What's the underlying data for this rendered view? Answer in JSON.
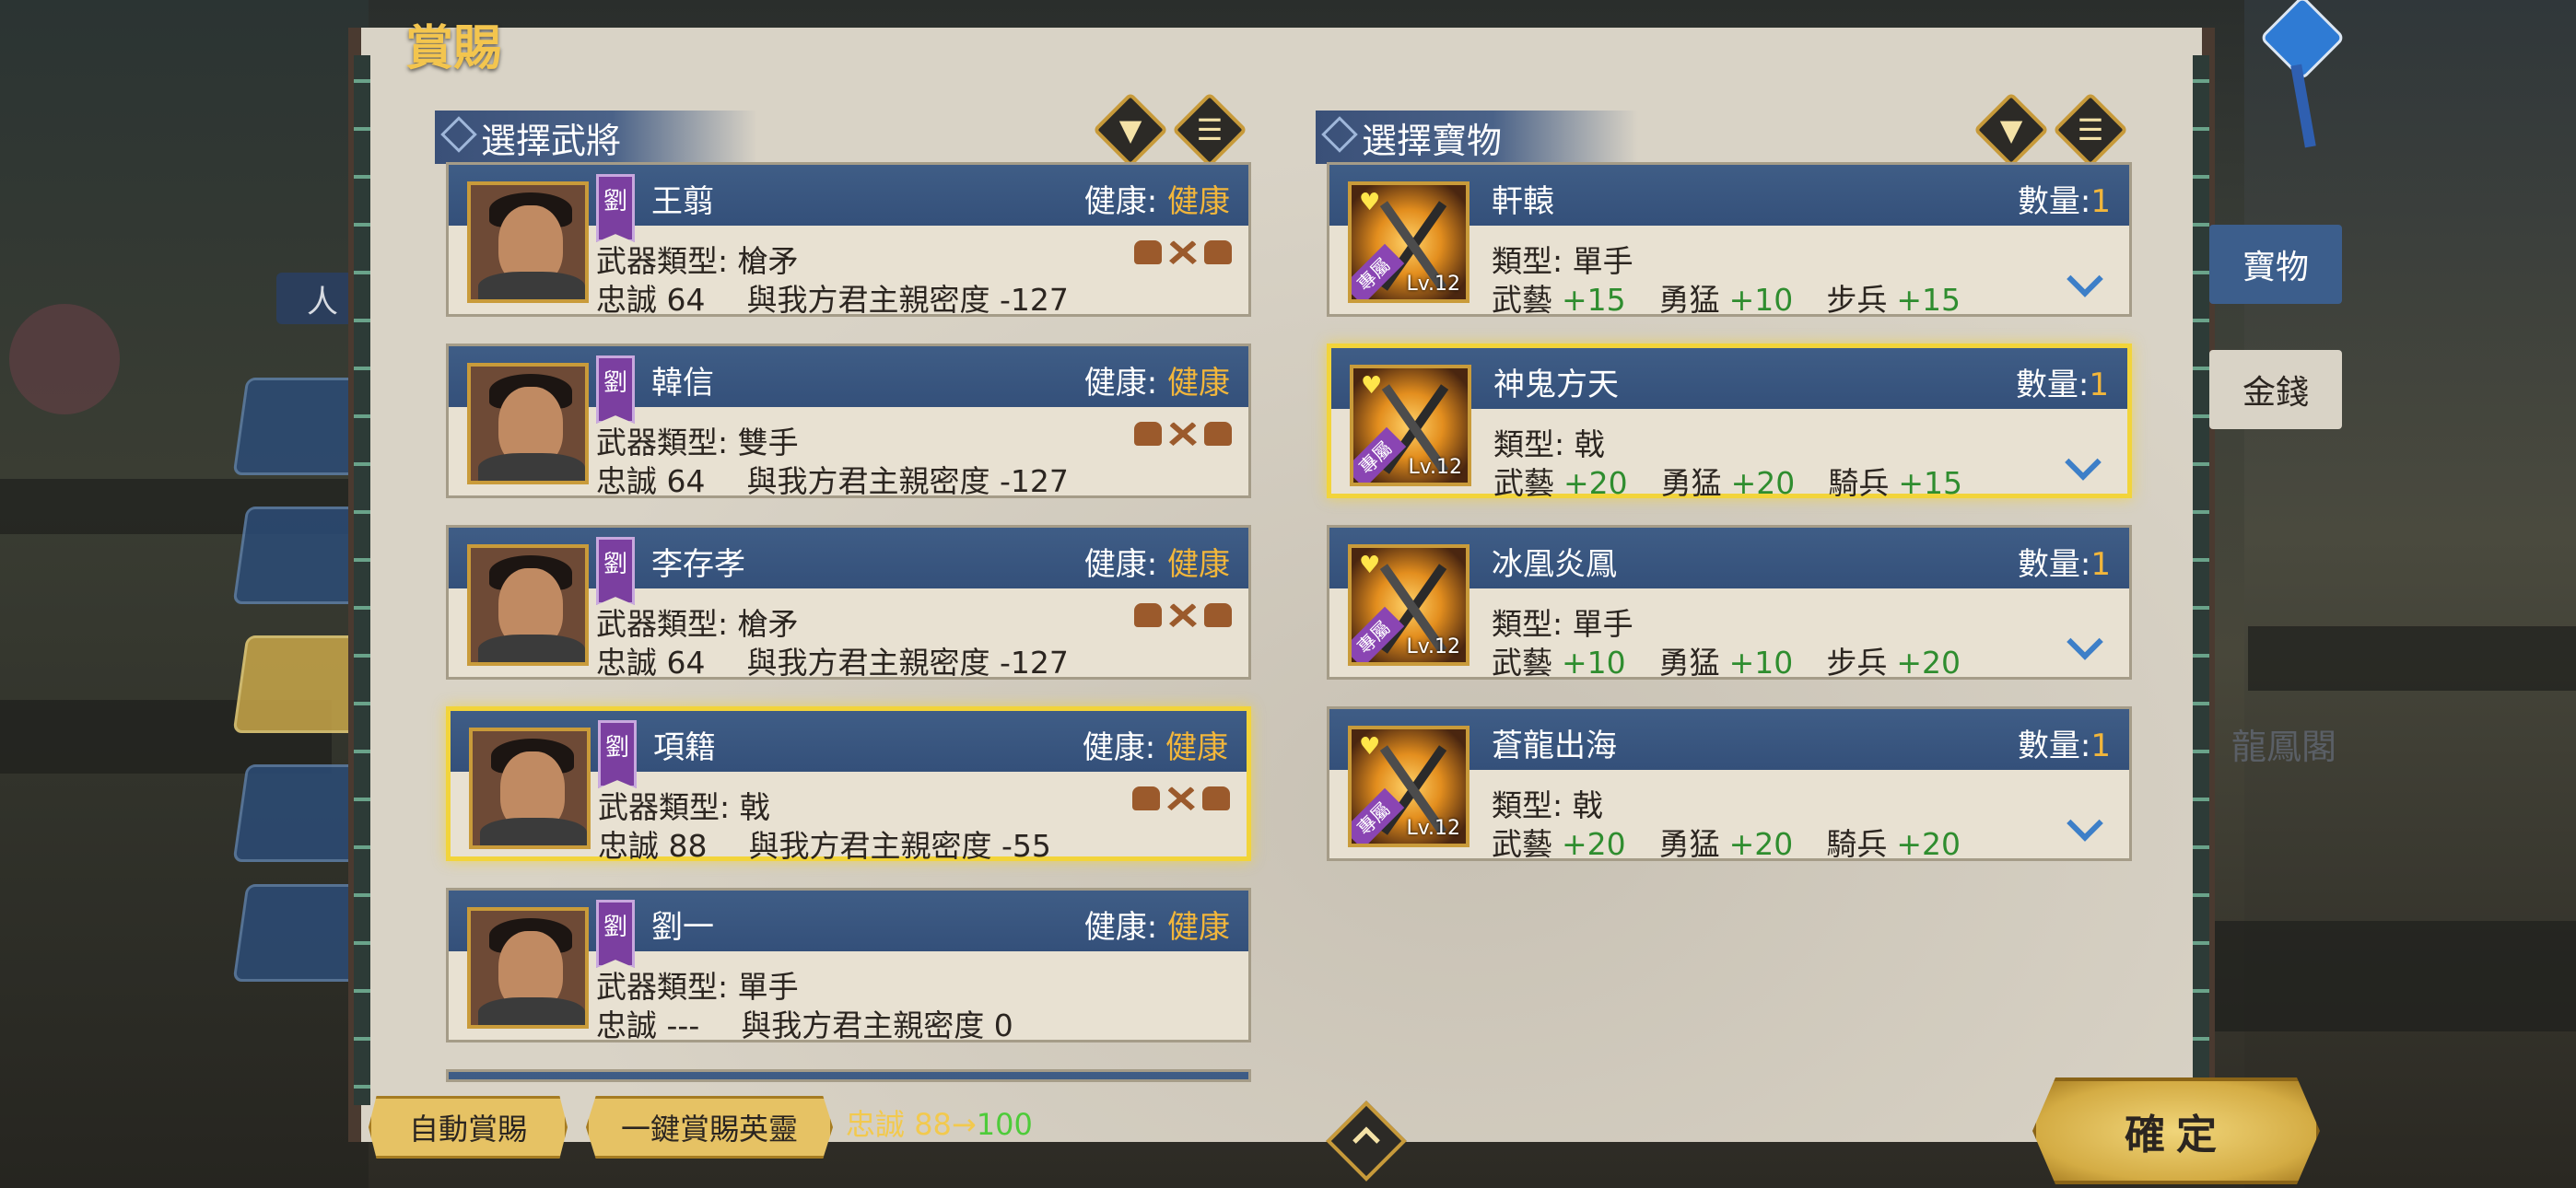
{
  "window_title": "賞賜",
  "left_section": {
    "title": "選擇武將"
  },
  "right_section": {
    "title": "選擇寶物"
  },
  "icons": {
    "filter": "filter-icon",
    "list": "list-icon"
  },
  "background": {
    "side_label": "人",
    "ghost_label": "龍鳳閣"
  },
  "generals": [
    {
      "faction": "劉",
      "name": "王翦",
      "health_label": "健康:",
      "health": "健康",
      "weapon_label": "武器類型:",
      "weapon": "槍矛",
      "loyalty_label": "忠誠",
      "loyalty": "64",
      "affinity_label": "與我方君主親密度",
      "affinity": "-127",
      "selected": false
    },
    {
      "faction": "劉",
      "name": "韓信",
      "health_label": "健康:",
      "health": "健康",
      "weapon_label": "武器類型:",
      "weapon": "雙手",
      "loyalty_label": "忠誠",
      "loyalty": "64",
      "affinity_label": "與我方君主親密度",
      "affinity": "-127",
      "selected": false
    },
    {
      "faction": "劉",
      "name": "李存孝",
      "health_label": "健康:",
      "health": "健康",
      "weapon_label": "武器類型:",
      "weapon": "槍矛",
      "loyalty_label": "忠誠",
      "loyalty": "64",
      "affinity_label": "與我方君主親密度",
      "affinity": "-127",
      "selected": false
    },
    {
      "faction": "劉",
      "name": "項籍",
      "health_label": "健康:",
      "health": "健康",
      "weapon_label": "武器類型:",
      "weapon": "戟",
      "loyalty_label": "忠誠",
      "loyalty": "88",
      "affinity_label": "與我方君主親密度",
      "affinity": "-55",
      "selected": true
    },
    {
      "faction": "劉",
      "name": "劉一",
      "health_label": "健康:",
      "health": "健康",
      "weapon_label": "武器類型:",
      "weapon": "單手",
      "loyalty_label": "忠誠",
      "loyalty": "---",
      "affinity_label": "與我方君主親密度",
      "affinity": "0",
      "selected": false
    }
  ],
  "treasures": [
    {
      "name": "軒轅",
      "qty_label": "數量:",
      "qty": "1",
      "type_label": "類型:",
      "type": "單手",
      "level": "Lv.12",
      "badge": "專屬",
      "stats": [
        {
          "k": "武藝",
          "v": "+15"
        },
        {
          "k": "勇猛",
          "v": "+10"
        },
        {
          "k": "步兵",
          "v": "+15"
        }
      ],
      "selected": false
    },
    {
      "name": "神鬼方天",
      "qty_label": "數量:",
      "qty": "1",
      "type_label": "類型:",
      "type": "戟",
      "level": "Lv.12",
      "badge": "專屬",
      "stats": [
        {
          "k": "武藝",
          "v": "+20"
        },
        {
          "k": "勇猛",
          "v": "+20"
        },
        {
          "k": "騎兵",
          "v": "+15"
        }
      ],
      "selected": true
    },
    {
      "name": "冰凰炎鳳",
      "qty_label": "數量:",
      "qty": "1",
      "type_label": "類型:",
      "type": "單手",
      "level": "Lv.12",
      "badge": "專屬",
      "stats": [
        {
          "k": "武藝",
          "v": "+10"
        },
        {
          "k": "勇猛",
          "v": "+10"
        },
        {
          "k": "步兵",
          "v": "+20"
        }
      ],
      "selected": false
    },
    {
      "name": "蒼龍出海",
      "qty_label": "數量:",
      "qty": "1",
      "type_label": "類型:",
      "type": "戟",
      "level": "Lv.12",
      "badge": "專屬",
      "stats": [
        {
          "k": "武藝",
          "v": "+20"
        },
        {
          "k": "勇猛",
          "v": "+20"
        },
        {
          "k": "騎兵",
          "v": "+20"
        }
      ],
      "selected": false
    }
  ],
  "right_tabs": [
    {
      "label": "寶物",
      "active": true
    },
    {
      "label": "金錢",
      "active": false
    }
  ],
  "bottom": {
    "auto_reward": "自動賞賜",
    "one_click": "一鍵賞賜英靈",
    "loyalty_label": "忠誠",
    "loyalty_from": "88→",
    "loyalty_to": "100",
    "confirm": "確定"
  },
  "colors": {
    "gold": "#f2b63b",
    "green": "#2f8d2f",
    "card_bar": "#3f5d86",
    "highlight": "#f2d43a"
  }
}
